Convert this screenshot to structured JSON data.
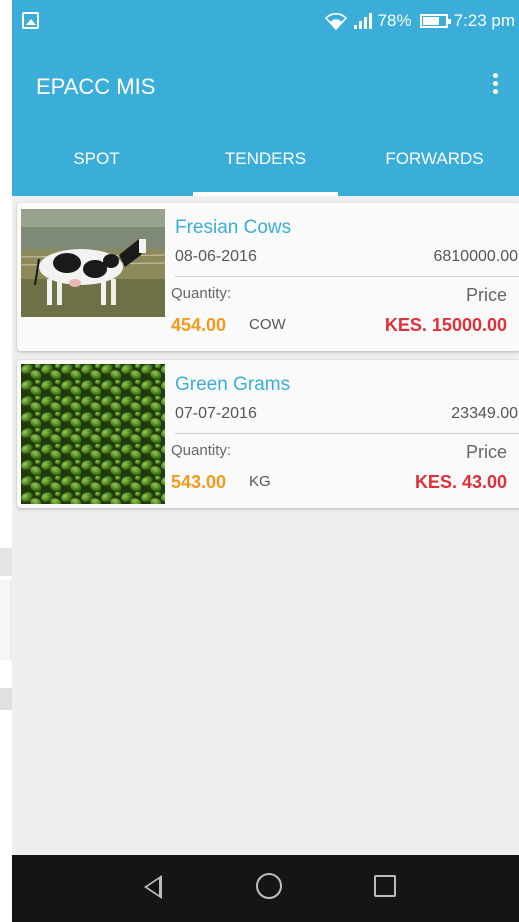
{
  "status_bar": {
    "battery": "78%",
    "time": "7:23 pm"
  },
  "app_bar": {
    "title": "EPACC MIS"
  },
  "tabs": [
    {
      "label": "SPOT",
      "active": false
    },
    {
      "label": "TENDERS",
      "active": true
    },
    {
      "label": "FORWARDS",
      "active": false
    }
  ],
  "listings": [
    {
      "name": "Fresian Cows",
      "date": "08-06-2016",
      "total": "6810000.00",
      "quantity_label": "Quantity:",
      "quantity": "454.00",
      "unit": "COW",
      "price_label": "Price",
      "price": "KES. 15000.00",
      "image": "holstein-cow-photo"
    },
    {
      "name": "Green Grams",
      "date": "07-07-2016",
      "total": "23349.00",
      "quantity_label": "Quantity:",
      "quantity": "543.00",
      "unit": "KG",
      "price_label": "Price",
      "price": "KES. 43.00",
      "image": "green-grams-photo"
    }
  ],
  "colors": {
    "primary": "#3aaed8",
    "quantity": "#f39a1e",
    "price": "#e0303a",
    "background": "#efefef",
    "nav_bar": "#151515"
  }
}
